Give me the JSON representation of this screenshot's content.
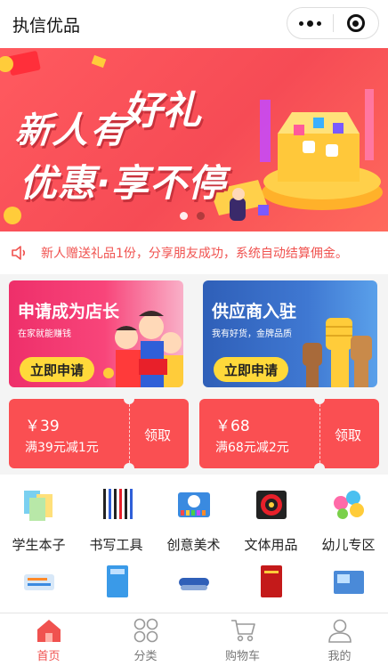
{
  "header": {
    "title": "执信优品"
  },
  "banner": {
    "line1a": "新人有",
    "line1b": "好礼",
    "line2": "优惠·享不停",
    "slides": 2,
    "active_slide": 1
  },
  "notice": {
    "text": "新人赠送礼品1份，分享朋友成功，系统自动结算佣金。"
  },
  "promos": [
    {
      "title": "申请成为店长",
      "subtitle": "在家就能赚钱",
      "button": "立即申请"
    },
    {
      "title": "供应商入驻",
      "subtitle": "我有好货，金牌品质",
      "button": "立即申请"
    }
  ],
  "coupons": [
    {
      "amount": "￥39",
      "condition": "满39元减1元",
      "action": "领取"
    },
    {
      "amount": "￥68",
      "condition": "满68元减2元",
      "action": "领取"
    }
  ],
  "categories": [
    {
      "label": "学生本子"
    },
    {
      "label": "书写工具"
    },
    {
      "label": "创意美术"
    },
    {
      "label": "文体用品"
    },
    {
      "label": "幼儿专区"
    }
  ],
  "tabs": [
    {
      "label": "首页",
      "icon": "home-icon",
      "active": true
    },
    {
      "label": "分类",
      "icon": "category-icon",
      "active": false
    },
    {
      "label": "购物车",
      "icon": "cart-icon",
      "active": false
    },
    {
      "label": "我的",
      "icon": "user-icon",
      "active": false
    }
  ],
  "colors": {
    "accent": "#f0524f",
    "coupon": "#fa4f52",
    "promo_pink": "#ee2f6a",
    "promo_blue": "#2f5fb8",
    "button_yellow": "#ffd93a"
  }
}
